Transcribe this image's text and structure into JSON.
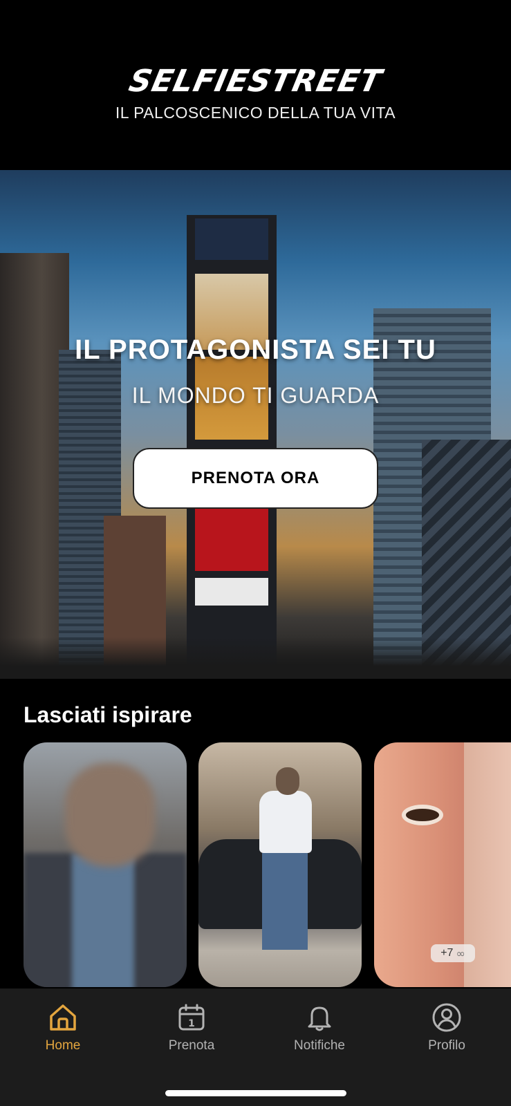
{
  "header": {
    "logo_text": "SELFIESTREET",
    "tagline": "IL PALCOSCENICO DELLA TUA VITA"
  },
  "hero": {
    "title": "IL PROTAGONISTA SEI TU",
    "subtitle": "IL MONDO TI GUARDA",
    "cta_label": "PRENOTA ORA"
  },
  "inspiration": {
    "title": "Lasciati ispirare",
    "cards": [
      {
        "kind": "photo",
        "badge": ""
      },
      {
        "kind": "photo",
        "badge": ""
      },
      {
        "kind": "photo-collection",
        "badge": "+7"
      }
    ]
  },
  "nav": {
    "items": [
      {
        "label": "Home",
        "icon": "home-icon",
        "active": true
      },
      {
        "label": "Prenota",
        "icon": "calendar-icon",
        "active": false
      },
      {
        "label": "Notifiche",
        "icon": "bell-icon",
        "active": false
      },
      {
        "label": "Profilo",
        "icon": "user-circle-icon",
        "active": false
      }
    ],
    "calendar_day": "1"
  },
  "colors": {
    "accent": "#e3a53e",
    "background": "#000000",
    "navbar": "#1c1c1c",
    "inactive": "#b3b3b3"
  }
}
